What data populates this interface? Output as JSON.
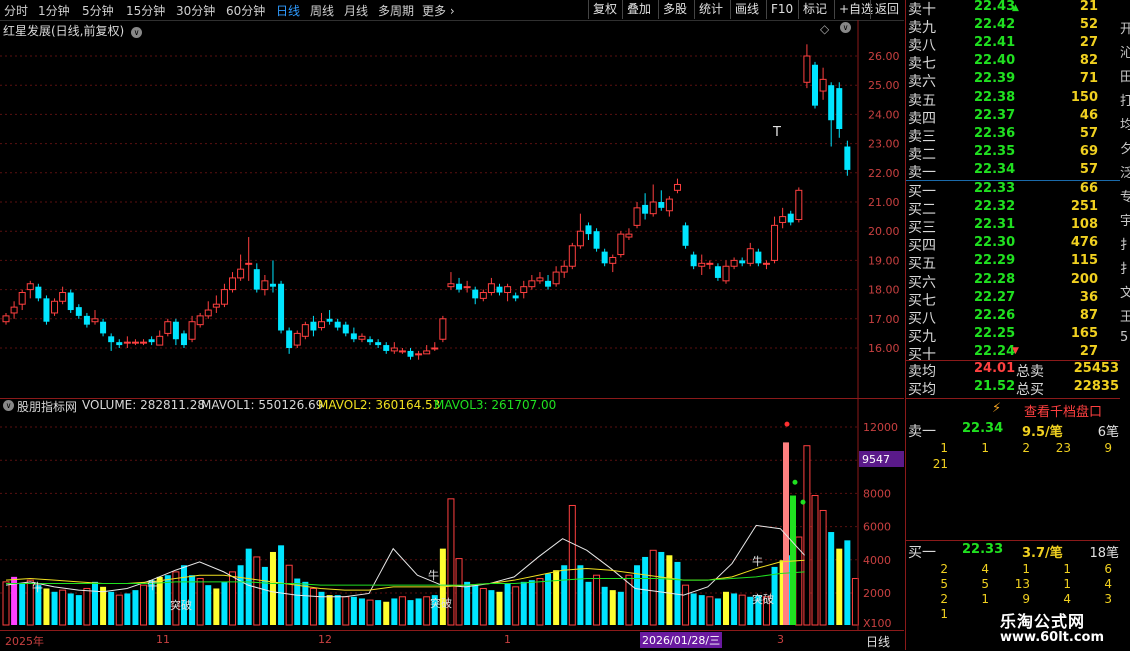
{
  "toolbar": {
    "periods": [
      "分时",
      "1分钟",
      "5分钟",
      "15分钟",
      "30分钟",
      "60分钟",
      "日线",
      "周线",
      "月线",
      "多周期",
      "更多"
    ],
    "active_period": "日线",
    "buttons": [
      "复权",
      "叠加",
      "多股",
      "统计",
      "画线",
      "F10",
      "标记",
      "+自选",
      "返回"
    ]
  },
  "chart": {
    "stock_title": "红星发展(日线,前复权)",
    "price_axis": [
      "26.00",
      "25.00",
      "24.00",
      "23.00",
      "22.00",
      "21.00",
      "20.00",
      "19.00",
      "18.00",
      "17.00",
      "16.00"
    ],
    "marker_text": "T"
  },
  "volume_panel": {
    "indicator_name": "股朋指标网",
    "volume": "VOLUME: 282811.28",
    "mavol1": "MAVOL1: 550126.69",
    "mavol2": "MAVOL2: 360164.53",
    "mavol3": "MAVOL3: 261707.00",
    "axis": [
      "12000",
      "10000",
      "8000",
      "6000",
      "4000",
      "2000"
    ],
    "highlight_value": "9547",
    "unit": "X100",
    "annotations": [
      "牛",
      "牛",
      "突破",
      "牛",
      "突破",
      "牛",
      "突破"
    ]
  },
  "date_axis": {
    "labels": [
      "2025年",
      "11",
      "12",
      "1",
      "3"
    ],
    "highlight_date": "2026/01/28/三",
    "period": "日线"
  },
  "quote": {
    "asks": [
      {
        "label": "卖十",
        "price": "22.43",
        "vol": "21"
      },
      {
        "label": "卖九",
        "price": "22.42",
        "vol": "52"
      },
      {
        "label": "卖八",
        "price": "22.41",
        "vol": "27"
      },
      {
        "label": "卖七",
        "price": "22.40",
        "vol": "82"
      },
      {
        "label": "卖六",
        "price": "22.39",
        "vol": "71"
      },
      {
        "label": "卖五",
        "price": "22.38",
        "vol": "150"
      },
      {
        "label": "卖四",
        "price": "22.37",
        "vol": "46"
      },
      {
        "label": "卖三",
        "price": "22.36",
        "vol": "57"
      },
      {
        "label": "卖二",
        "price": "22.35",
        "vol": "69"
      },
      {
        "label": "卖一",
        "price": "22.34",
        "vol": "57"
      }
    ],
    "bids": [
      {
        "label": "买一",
        "price": "22.33",
        "vol": "66"
      },
      {
        "label": "买二",
        "price": "22.32",
        "vol": "251"
      },
      {
        "label": "买三",
        "price": "22.31",
        "vol": "108"
      },
      {
        "label": "买四",
        "price": "22.30",
        "vol": "476"
      },
      {
        "label": "买五",
        "price": "22.29",
        "vol": "115"
      },
      {
        "label": "买六",
        "price": "22.28",
        "vol": "200"
      },
      {
        "label": "买七",
        "price": "22.27",
        "vol": "36"
      },
      {
        "label": "买八",
        "price": "22.26",
        "vol": "87"
      },
      {
        "label": "买九",
        "price": "22.25",
        "vol": "165"
      },
      {
        "label": "买十",
        "price": "22.24",
        "vol": "27"
      }
    ],
    "avg_sell_label": "卖均",
    "avg_sell": "24.01",
    "total_sell_label": "总卖",
    "total_sell": "25453",
    "avg_buy_label": "买均",
    "avg_buy": "21.52",
    "total_buy_label": "总买",
    "total_buy": "22835",
    "view_depth": "查看千档盘口",
    "sell1_label": "卖一",
    "sell1_price": "22.34",
    "sell1_per": "9.5/笔",
    "sell1_count": "6笔",
    "sell1_queue": [
      [
        "1",
        "1",
        "2",
        "23",
        "9"
      ],
      [
        "21",
        "",
        "",
        "",
        ""
      ]
    ],
    "buy1_label": "买一",
    "buy1_price": "22.33",
    "buy1_per": "3.7/笔",
    "buy1_count": "18笔",
    "buy1_queue": [
      [
        "2",
        "4",
        "1",
        "1",
        "6"
      ],
      [
        "5",
        "5",
        "13",
        "1",
        "4"
      ],
      [
        "2",
        "1",
        "9",
        "4",
        "3"
      ],
      [
        "1",
        "",
        "",
        "",
        ""
      ]
    ]
  },
  "edge_text": [
    "开",
    "沁",
    "田",
    "打",
    "均",
    "夕",
    "泛",
    "专",
    "宇",
    "扌",
    "扌",
    "文",
    "王",
    "5"
  ],
  "watermark": {
    "line1": "乐淘公式网",
    "line2": "www.60lt.com"
  },
  "colors": {
    "up": "#ff4040",
    "down": "#00e5ff",
    "ask_price": "#20e020",
    "vol": "#f0d020"
  }
}
